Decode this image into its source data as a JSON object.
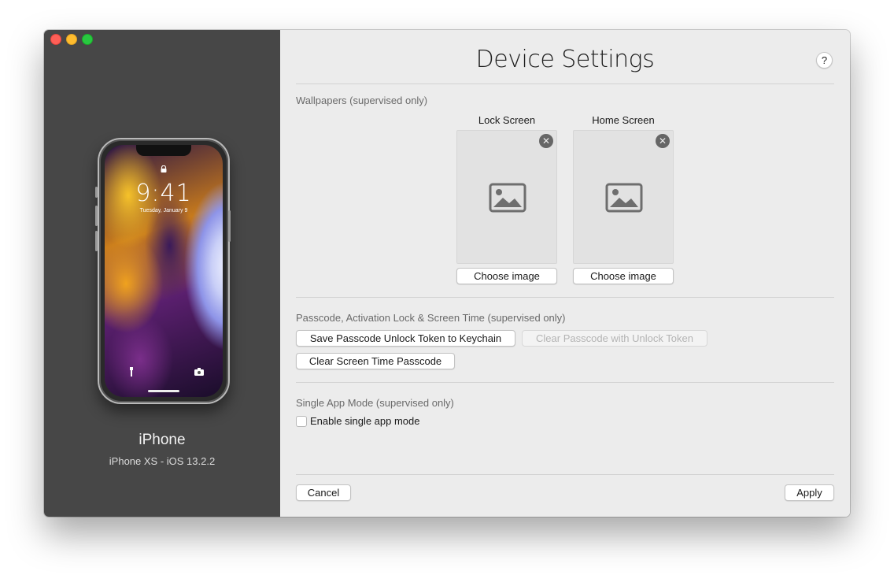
{
  "window": {
    "traffic_lights": {
      "close": "#fe5f57",
      "minimize": "#febc2e",
      "maximize": "#28c840"
    }
  },
  "sidebar": {
    "device_name": "iPhone",
    "device_detail": "iPhone XS - iOS 13.2.2",
    "lock_screen_time": "9:41",
    "lock_screen_date": "Tuesday, January 9"
  },
  "header": {
    "title": "Device Settings",
    "help_label": "?"
  },
  "wallpapers": {
    "section_label": "Wallpapers (supervised only)",
    "lock_screen": {
      "title": "Lock Screen",
      "button": "Choose image",
      "remove_icon": "close-circle-icon",
      "placeholder_icon": "image-placeholder-icon"
    },
    "home_screen": {
      "title": "Home Screen",
      "button": "Choose image",
      "remove_icon": "close-circle-icon",
      "placeholder_icon": "image-placeholder-icon"
    }
  },
  "passcode": {
    "section_label": "Passcode, Activation Lock & Screen Time (supervised only)",
    "save_token_button": "Save Passcode Unlock Token to Keychain",
    "clear_passcode_button": "Clear Passcode with Unlock Token",
    "clear_passcode_enabled": false,
    "clear_screen_time_button": "Clear Screen Time Passcode"
  },
  "single_app": {
    "section_label": "Single App Mode (supervised only)",
    "checkbox_label": "Enable single app mode",
    "checked": false
  },
  "footer": {
    "cancel": "Cancel",
    "apply": "Apply"
  }
}
